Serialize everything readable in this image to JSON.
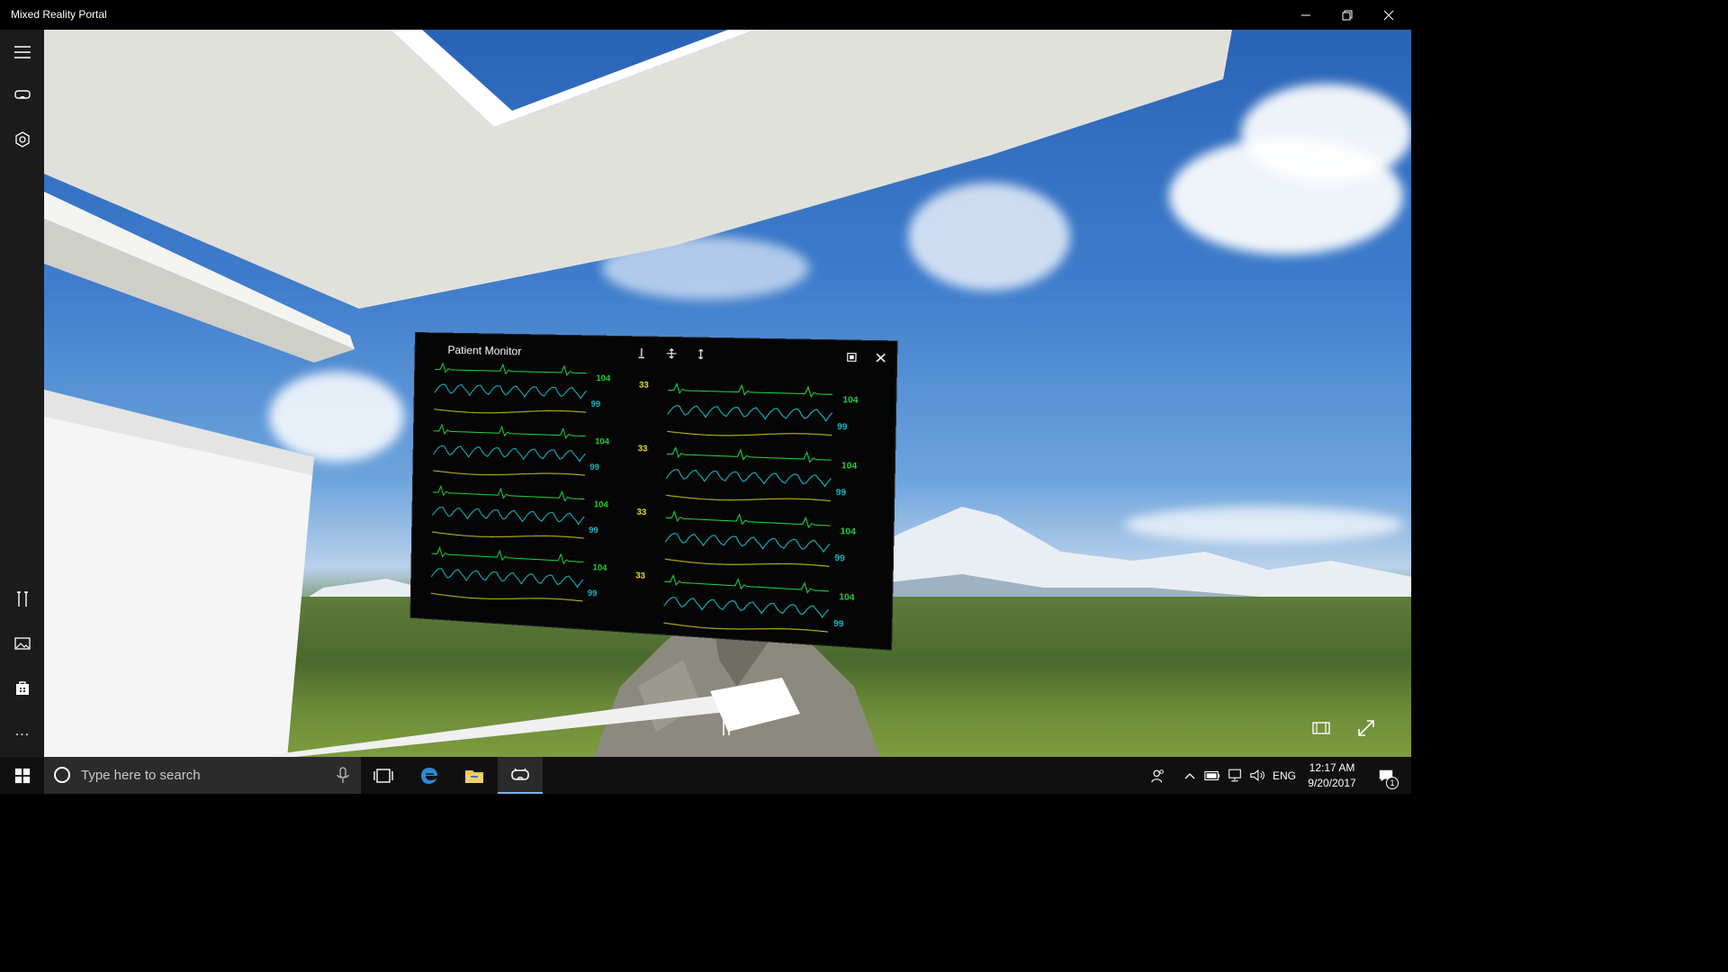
{
  "window": {
    "title": "Mixed Reality Portal",
    "controls": {
      "minimize": "minimize-icon",
      "restore": "restore-icon",
      "close": "close-icon"
    }
  },
  "rail": {
    "items": [
      {
        "name": "menu",
        "icon": "hamburger-icon"
      },
      {
        "name": "headset",
        "icon": "headset-icon"
      },
      {
        "name": "mixed-reality",
        "icon": "mixed-reality-icon"
      },
      {
        "name": "tools",
        "icon": "tools-icon"
      },
      {
        "name": "photos",
        "icon": "photos-icon"
      },
      {
        "name": "store",
        "icon": "store-icon"
      },
      {
        "name": "more",
        "icon": "more-icon",
        "label": "..."
      }
    ]
  },
  "monitor": {
    "title": "Patient Monitor",
    "values": {
      "hr": "104",
      "resp": "33",
      "spo2": "99"
    },
    "colors": {
      "ecg": "#1fd13a",
      "spo2": "#16b9c7",
      "resp": "#c9c31a",
      "label": "#f2e21c"
    }
  },
  "overlay": {
    "pause": "pause-icon",
    "fit": "fit-icon",
    "expand": "expand-icon"
  },
  "taskbar": {
    "search_placeholder": "Type here to search",
    "apps": [
      "task-view-icon",
      "edge-icon",
      "file-explorer-icon",
      "mixed-reality-portal-icon"
    ],
    "tray": {
      "lang": "ENG",
      "time": "12:17 AM",
      "date": "9/20/2017",
      "notifications": "1"
    }
  },
  "colors": {
    "accent": "#7fb4e6",
    "rail_bg": "#1b1b1b",
    "taskbar_bg": "#101010"
  }
}
